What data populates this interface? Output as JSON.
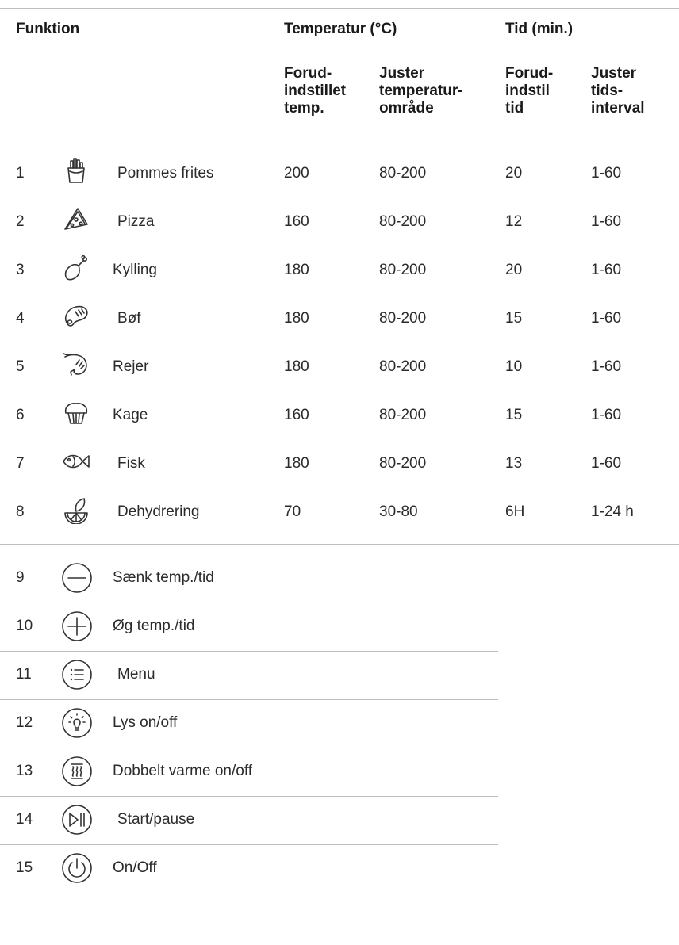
{
  "header": {
    "function": "Funktion",
    "temperature": "Temperatur (°C)",
    "time": "Tid (min.)",
    "temp_preset": "Forud-\nindstillet\ntemp.",
    "temp_adjust": "Juster\ntemperatur-\nområde",
    "time_preset": "Forud-\nindstil\ntid",
    "time_adjust": "Juster\ntids-\ninterval"
  },
  "programs": [
    {
      "num": "1",
      "icon": "fries-icon",
      "label": "Pommes frites",
      "temp": "200",
      "temp_range": "80-200",
      "time": "20",
      "time_range": "1-60"
    },
    {
      "num": "2",
      "icon": "pizza-icon",
      "label": "Pizza",
      "temp": "160",
      "temp_range": "80-200",
      "time": "12",
      "time_range": "1-60"
    },
    {
      "num": "3",
      "icon": "chicken-leg-icon",
      "label": "Kylling",
      "temp": "180",
      "temp_range": "80-200",
      "time": "20",
      "time_range": "1-60"
    },
    {
      "num": "4",
      "icon": "steak-icon",
      "label": "Bøf",
      "temp": "180",
      "temp_range": "80-200",
      "time": "15",
      "time_range": "1-60"
    },
    {
      "num": "5",
      "icon": "shrimp-icon",
      "label": "Rejer",
      "temp": "180",
      "temp_range": "80-200",
      "time": "10",
      "time_range": "1-60"
    },
    {
      "num": "6",
      "icon": "cake-icon",
      "label": "Kage",
      "temp": "160",
      "temp_range": "80-200",
      "time": "15",
      "time_range": "1-60"
    },
    {
      "num": "7",
      "icon": "fish-icon",
      "label": "Fisk",
      "temp": "180",
      "temp_range": "80-200",
      "time": "13",
      "time_range": "1-60"
    },
    {
      "num": "8",
      "icon": "dehydrate-fruit-icon",
      "label": "Dehydrering",
      "temp": "70",
      "temp_range": "30-80",
      "time": "6H",
      "time_range": "1-24 h"
    }
  ],
  "controls": [
    {
      "num": "9",
      "icon": "minus-circle-icon",
      "label": "Sænk temp./tid"
    },
    {
      "num": "10",
      "icon": "plus-circle-icon",
      "label": "Øg temp./tid"
    },
    {
      "num": "11",
      "icon": "menu-circle-icon",
      "label": "Menu"
    },
    {
      "num": "12",
      "icon": "light-bulb-circle-icon",
      "label": "Lys on/off"
    },
    {
      "num": "13",
      "icon": "double-heat-circle-icon",
      "label": "Dobbelt varme on/off"
    },
    {
      "num": "14",
      "icon": "play-pause-circle-icon",
      "label": "Start/pause"
    },
    {
      "num": "15",
      "icon": "power-circle-icon",
      "label": "On/Off"
    }
  ]
}
